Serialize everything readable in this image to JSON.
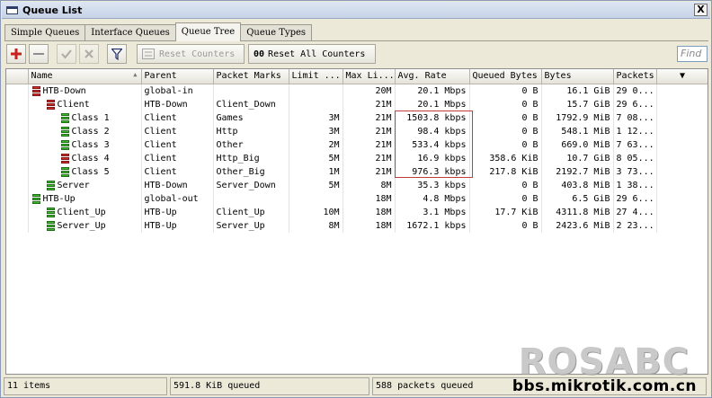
{
  "window": {
    "title": "Queue List",
    "close_glyph": "X"
  },
  "tabs": [
    {
      "label": "Simple Queues",
      "active": false
    },
    {
      "label": "Interface Queues",
      "active": false
    },
    {
      "label": "Queue Tree",
      "active": true
    },
    {
      "label": "Queue Types",
      "active": false
    }
  ],
  "toolbar": {
    "add_icon": "plus-icon",
    "remove_icon": "minus-icon",
    "enable_icon": "check-icon",
    "disable_icon": "cross-icon",
    "filter_icon": "filter-icon",
    "reset_counters_label": "Reset Counters",
    "reset_all_counters_label": "Reset All Counters",
    "reset_all_prefix": "00",
    "find_placeholder": "Find"
  },
  "table": {
    "columns": [
      "Name",
      "Parent",
      "Packet Marks",
      "Limit ...",
      "Max Li...",
      "Avg. Rate",
      "Queued Bytes",
      "Bytes",
      "Packets"
    ],
    "rows": [
      {
        "level": 0,
        "icon": "red",
        "name": "HTB-Down",
        "parent": "global-in",
        "marks": "",
        "limit": "",
        "max": "20M",
        "rate": "20.1 Mbps",
        "queued": "0 B",
        "bytes": "16.1 GiB",
        "packets": "29 0..."
      },
      {
        "level": 1,
        "icon": "red",
        "name": "Client",
        "parent": "HTB-Down",
        "marks": "Client_Down",
        "limit": "",
        "max": "21M",
        "rate": "20.1 Mbps",
        "queued": "0 B",
        "bytes": "15.7 GiB",
        "packets": "29 6..."
      },
      {
        "level": 2,
        "icon": "green",
        "name": "Class 1",
        "parent": "Client",
        "marks": "Games",
        "limit": "3M",
        "max": "21M",
        "rate": "1503.8 kbps",
        "queued": "0 B",
        "bytes": "1792.9 MiB",
        "packets": "7 08..."
      },
      {
        "level": 2,
        "icon": "green",
        "name": "Class 2",
        "parent": "Client",
        "marks": "Http",
        "limit": "3M",
        "max": "21M",
        "rate": "98.4 kbps",
        "queued": "0 B",
        "bytes": "548.1 MiB",
        "packets": "1 12..."
      },
      {
        "level": 2,
        "icon": "green",
        "name": "Class 3",
        "parent": "Client",
        "marks": "Other",
        "limit": "2M",
        "max": "21M",
        "rate": "533.4 kbps",
        "queued": "0 B",
        "bytes": "669.0 MiB",
        "packets": "7 63..."
      },
      {
        "level": 2,
        "icon": "red",
        "name": "Class 4",
        "parent": "Client",
        "marks": "Http_Big",
        "limit": "5M",
        "max": "21M",
        "rate": "16.9 kbps",
        "queued": "358.6 KiB",
        "bytes": "10.7 GiB",
        "packets": "8 05..."
      },
      {
        "level": 2,
        "icon": "green",
        "name": "Class 5",
        "parent": "Client",
        "marks": "Other_Big",
        "limit": "1M",
        "max": "21M",
        "rate": "976.3 kbps",
        "queued": "217.8 KiB",
        "bytes": "2192.7 MiB",
        "packets": "3 73..."
      },
      {
        "level": 1,
        "icon": "green",
        "name": "Server",
        "parent": "HTB-Down",
        "marks": "Server_Down",
        "limit": "5M",
        "max": "8M",
        "rate": "35.3 kbps",
        "queued": "0 B",
        "bytes": "403.8 MiB",
        "packets": "1 38..."
      },
      {
        "level": 0,
        "icon": "green",
        "name": "HTB-Up",
        "parent": "global-out",
        "marks": "",
        "limit": "",
        "max": "18M",
        "rate": "4.8 Mbps",
        "queued": "0 B",
        "bytes": "6.5 GiB",
        "packets": "29 6..."
      },
      {
        "level": 1,
        "icon": "green",
        "name": "Client_Up",
        "parent": "HTB-Up",
        "marks": "Client_Up",
        "limit": "10M",
        "max": "18M",
        "rate": "3.1 Mbps",
        "queued": "17.7 KiB",
        "bytes": "4311.8 MiB",
        "packets": "27 4..."
      },
      {
        "level": 1,
        "icon": "green",
        "name": "Server_Up",
        "parent": "HTB-Up",
        "marks": "Server_Up",
        "limit": "8M",
        "max": "18M",
        "rate": "1672.1 kbps",
        "queued": "0 B",
        "bytes": "2423.6 MiB",
        "packets": "2 23..."
      }
    ]
  },
  "status": {
    "items": "11 items",
    "queued": "591.8 KiB queued",
    "packets": "588 packets queued"
  },
  "watermark": {
    "big": "ROSABC",
    "small": "bbs.mikrotik.com.cn"
  },
  "colors": {
    "green_queue": "#3fbf2e",
    "red_queue": "#dd2a2a",
    "highlight_box": "#c33b3b"
  }
}
